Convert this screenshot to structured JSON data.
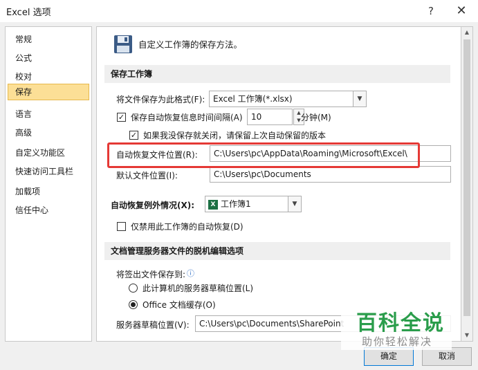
{
  "window": {
    "title": "Excel 选项",
    "help_glyph": "?",
    "close_glyph": "✕"
  },
  "sidebar": {
    "items": [
      {
        "label": "常规"
      },
      {
        "label": "公式"
      },
      {
        "label": "校对"
      },
      {
        "label": "保存",
        "selected": true
      },
      {
        "label": "语言"
      },
      {
        "label": "高级"
      },
      {
        "label": "自定义功能区"
      },
      {
        "label": "快速访问工具栏"
      },
      {
        "label": "加载项"
      },
      {
        "label": "信任中心"
      }
    ]
  },
  "main": {
    "header": "自定义工作簿的保存方法。",
    "save_workbooks": {
      "title": "保存工作簿",
      "format_label": "将文件保存为此格式(F):",
      "format_value": "Excel 工作簿(*.xlsx)",
      "autorecover_label": "保存自动恢复信息时间间隔(A)",
      "autorecover_checked": true,
      "autorecover_minutes": "10",
      "minutes_label": "分钟(M)",
      "keep_last_label": "如果我没保存就关闭，请保留上次自动保留的版本",
      "keep_last_checked": true,
      "autorecover_location_label": "自动恢复文件位置(R):",
      "autorecover_location_value": "C:\\Users\\pc\\AppData\\Roaming\\Microsoft\\Excel\\",
      "default_location_label": "默认文件位置(I):",
      "default_location_value": "C:\\Users\\pc\\Documents"
    },
    "autorecover_exceptions": {
      "label": "自动恢复例外情况(X):",
      "workbook": "工作簿1",
      "disable_label": "仅禁用此工作簿的自动恢复(D)",
      "disable_checked": false
    },
    "offline_editing": {
      "title": "文档管理服务器文件的脱机编辑选项",
      "save_to_label": "将签出文件保存到:",
      "info_glyph": "ⓘ",
      "options": [
        {
          "label": "此计算机的服务器草稿位置(L)",
          "selected": false
        },
        {
          "label": "Office 文档缓存(O)",
          "selected": true
        }
      ],
      "drafts_label": "服务器草稿位置(V):",
      "drafts_value": "C:\\Users\\pc\\Documents\\SharePoint"
    }
  },
  "buttons": {
    "ok": "确定",
    "cancel": "取消"
  },
  "watermark": {
    "title": "百科全说",
    "subtitle": "助你轻松解决"
  },
  "colors": {
    "selected_bg": "#fcdf96",
    "highlight_border": "#e53935",
    "watermark_green": "#2a9d4b",
    "excel_green": "#1d7044"
  }
}
